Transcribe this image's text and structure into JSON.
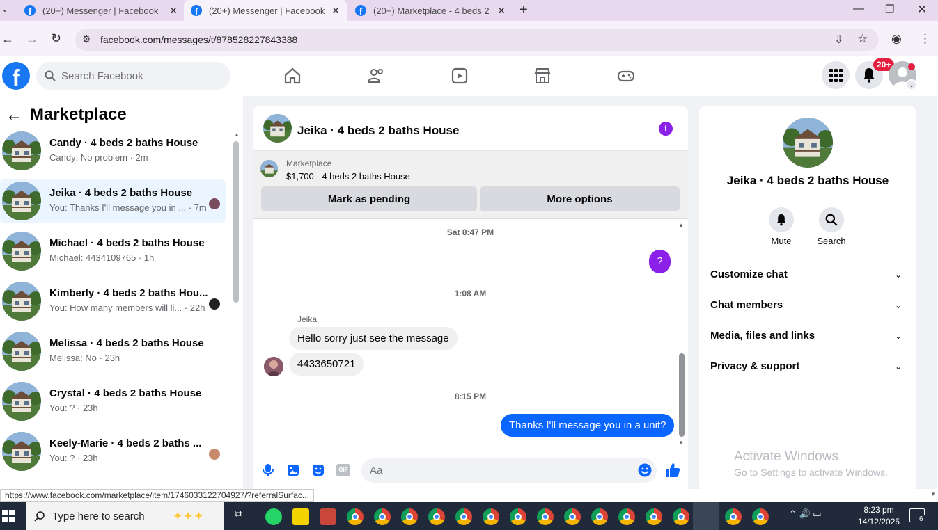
{
  "browser": {
    "tabs": [
      {
        "label": "(20+) Messenger | Facebook"
      },
      {
        "label": "(20+) Messenger | Facebook"
      },
      {
        "label": "(20+) Marketplace - 4 beds 2 b"
      }
    ],
    "url": "facebook.com/messages/t/878528227843388"
  },
  "header": {
    "search_placeholder": "Search Facebook",
    "notif_badge": "20+"
  },
  "sidebar": {
    "title": "Marketplace",
    "conversations": [
      {
        "name": "Candy · 4 beds 2 baths House",
        "preview": "Candy: No problem · 2m"
      },
      {
        "name": "Jeika · 4 beds 2 baths House",
        "preview": "You: Thanks I'll message you in ... · 7m"
      },
      {
        "name": "Michael · 4 beds 2 baths House",
        "preview": "Michael: 4434109765 · 1h"
      },
      {
        "name": "Kimberly · 4 beds 2 baths Hou...",
        "preview": "You: How many members will li... · 22h"
      },
      {
        "name": "Melissa · 4 beds 2 baths House",
        "preview": "Melissa: No · 23h"
      },
      {
        "name": "Crystal · 4 beds 2 baths House",
        "preview": "You: ? · 23h"
      },
      {
        "name": "Keely-Marie · 4 beds 2 baths ...",
        "preview": "You: ? · 23h"
      }
    ]
  },
  "chat": {
    "title": "Jeika · 4 beds 2 baths House",
    "listing_label": "Marketplace",
    "listing_title": "$1,700 - 4 beds 2 baths House",
    "mark_pending": "Mark as pending",
    "more_options": "More options",
    "ts1": "Sat 8:47 PM",
    "out_q": "?",
    "ts2": "1:08 AM",
    "sender": "Jeika",
    "msg1": "Hello sorry just see the message",
    "msg2": "4433650721",
    "ts3": "8:15 PM",
    "msg3": "Thanks I'll message you in a unit?",
    "composer_placeholder": "Aa"
  },
  "rightpanel": {
    "name": "Jeika · 4 beds 2 baths House",
    "mute": "Mute",
    "search": "Search",
    "sections": [
      "Customize chat",
      "Chat members",
      "Media, files and links",
      "Privacy & support"
    ],
    "watermark_title": "Activate Windows",
    "watermark_sub": "Go to Settings to activate Windows."
  },
  "status_url": "https://www.facebook.com/marketplace/item/1746033122704927/?referralSurfac...",
  "taskbar": {
    "search_placeholder": "Type here to search",
    "time": "8:23 pm",
    "date": "14/12/2025",
    "notif_count": "6"
  },
  "colors": {
    "accent": "#0a66ff",
    "brand": "#1877f2",
    "purple": "#8b20e8",
    "badge": "#e41e3f"
  }
}
